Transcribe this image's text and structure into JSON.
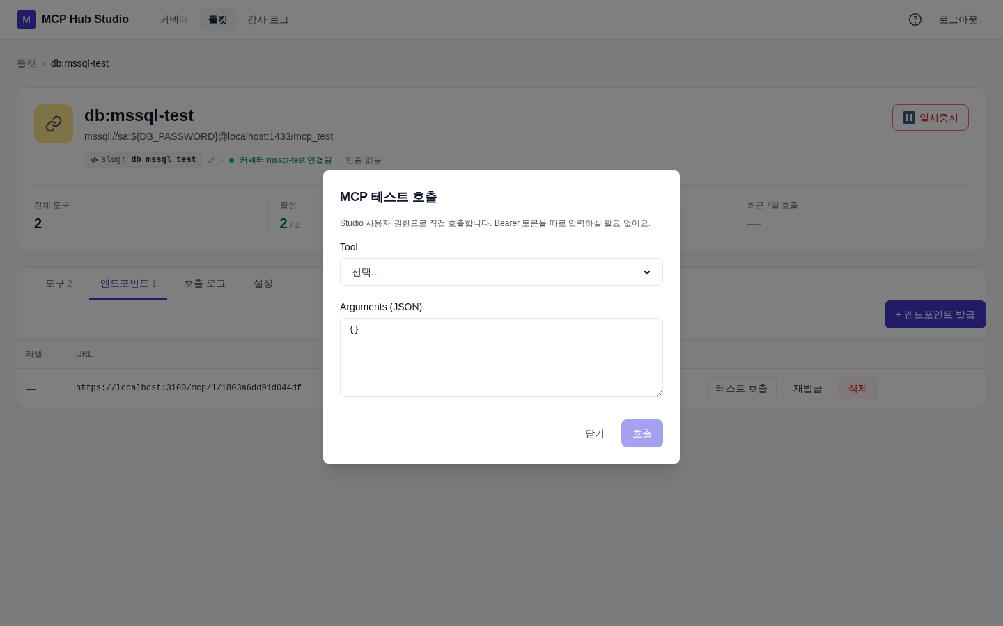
{
  "nav": {
    "logo_letter": "M",
    "brand": "MCP Hub Studio",
    "items": [
      {
        "label": "커넥터",
        "selected": false
      },
      {
        "label": "툴킷",
        "selected": true
      },
      {
        "label": "감사 로그",
        "selected": false
      }
    ],
    "logout": "로그아웃"
  },
  "breadcrumb": {
    "parent": "툴킷",
    "separator": "›",
    "current": "db:mssql-test"
  },
  "toolkit": {
    "title": "db:mssql-test",
    "dsn": "mssql://sa:${DB_PASSWORD}@localhost:1433/mcp_test",
    "slug_label": "slug:",
    "slug": "db_mssql_test",
    "connector_status": "커넥터 mssql-test 연결됨",
    "connected": true,
    "auth": "인증 없음",
    "pause_button": "일시중지"
  },
  "stats": [
    {
      "label": "전체 도구",
      "value": "2",
      "kind": "plain"
    },
    {
      "label": "활성",
      "value": "2",
      "total": "/ 2",
      "kind": "ratio"
    },
    {
      "label": "최근 7일 호출",
      "value": "—",
      "kind": "empty"
    }
  ],
  "tabs": [
    {
      "label": "도구",
      "count": "2",
      "selected": false
    },
    {
      "label": "엔드포인트",
      "count": "1",
      "selected": true
    },
    {
      "label": "호출 로그",
      "selected": false
    },
    {
      "label": "설정",
      "selected": false
    }
  ],
  "issue_button": "+ 엔드포인트 발급",
  "table": {
    "columns": [
      "라벨",
      "URL"
    ],
    "rows": [
      {
        "label": "—",
        "url": "https://localhost:3100/mcp/1/1803a6dd91d044df",
        "actions": [
          {
            "label": "테스트 호출",
            "kind": "outline"
          },
          {
            "label": "재발급",
            "kind": "plain"
          },
          {
            "label": "삭제",
            "kind": "danger"
          }
        ]
      }
    ]
  },
  "dialog": {
    "title": "MCP 테스트 호출",
    "description": "Studio 사용자 권한으로 직접 호출합니다. Bearer 토큰을 따로 입력하실 필요 없어요.",
    "tool_label": "Tool",
    "tool_value": "선택...",
    "args_label": "Arguments (JSON)",
    "args_value": "{}",
    "close_button": "닫기",
    "call_button": {
      "label": "호출",
      "disabled": true
    }
  }
}
